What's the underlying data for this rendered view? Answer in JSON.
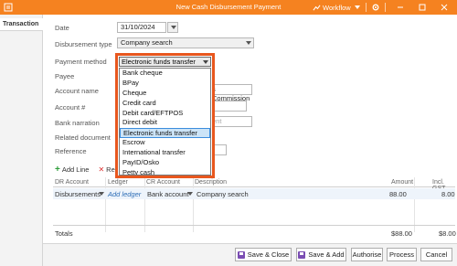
{
  "window": {
    "title": "New Cash Disbursement Payment",
    "workflow_label": "Workflow"
  },
  "tabs": {
    "transaction": "Transaction"
  },
  "form": {
    "date_label": "Date",
    "date_value": "31/10/2024",
    "disbursement_type_label": "Disbursement type",
    "disbursement_type_value": "Company search",
    "payment_method_label": "Payment method",
    "payee_label": "Payee",
    "account_name_label": "Account name",
    "account_name_value_partial": "s Commission",
    "account_number_label": "Account #",
    "bank_narration_label": "Bank narration",
    "bank_narration_placeholder_partial": "ent",
    "related_document_label": "Related document",
    "reference_label": "Reference"
  },
  "dropdown": {
    "selected": "Electronic funds transfer",
    "options": [
      "Bank cheque",
      "BPay",
      "Cheque",
      "Credit card",
      "Debit card/EFTPOS",
      "Direct debit",
      "Electronic funds transfer",
      "Escrow",
      "International transfer",
      "PayID/Osko",
      "Petty cash"
    ],
    "highlighted_index": 6
  },
  "toolbar": {
    "add_line": "Add Line",
    "remove_partial": "Re"
  },
  "grid": {
    "headers": {
      "dr_account": "DR Account",
      "ledger": "Ledger",
      "cr_account": "CR Account",
      "description": "Description",
      "amount": "Amount",
      "incl_gst": "Incl. GST"
    },
    "row": {
      "dr_account": "Disbursements",
      "ledger": "Add ledger",
      "cr_account": "Bank account",
      "description": "Company search",
      "amount": "88.00",
      "incl_gst": "8.00"
    }
  },
  "totals": {
    "label": "Totals",
    "amount": "$88.00",
    "gst": "$8.00"
  },
  "footer": {
    "save_close": "Save & Close",
    "save_add": "Save & Add",
    "authorise": "Authorise",
    "process": "Process",
    "cancel": "Cancel"
  },
  "colors": {
    "titlebar": "#f58220",
    "dropdown_border": "#e8571e",
    "highlight": "#cce4f7"
  }
}
